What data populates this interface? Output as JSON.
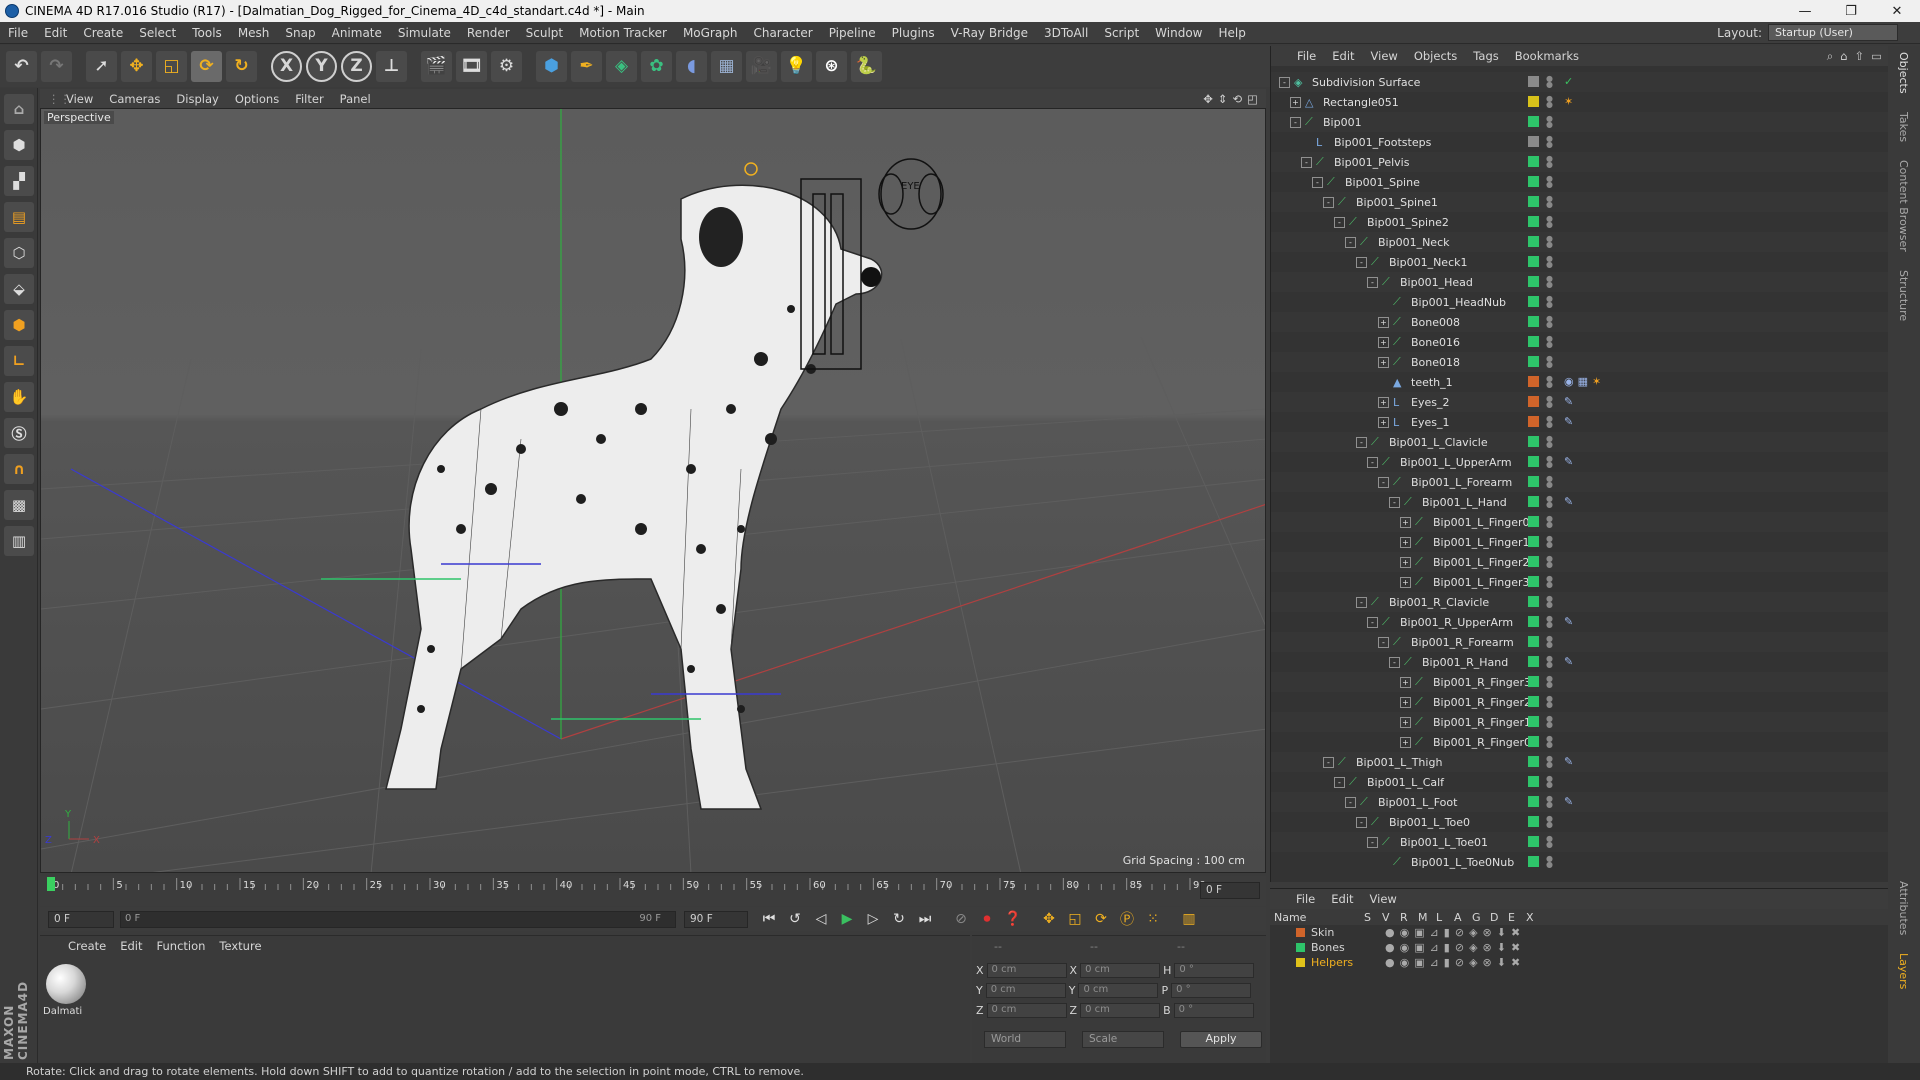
{
  "window": {
    "title": "CINEMA 4D R17.016 Studio (R17) - [Dalmatian_Dog_Rigged_for_Cinema_4D_c4d_standart.c4d *] - Main"
  },
  "menubar": {
    "items": [
      "File",
      "Edit",
      "Create",
      "Select",
      "Tools",
      "Mesh",
      "Snap",
      "Animate",
      "Simulate",
      "Render",
      "Sculpt",
      "Motion Tracker",
      "MoGraph",
      "Character",
      "Pipeline",
      "Plugins",
      "V-Ray Bridge",
      "3DToAll",
      "Script",
      "Window",
      "Help"
    ],
    "layout_label": "Layout:",
    "layout_value": "Startup (User)"
  },
  "toolbar": {
    "x_axis": "X",
    "y_axis": "Y",
    "z_axis": "Z"
  },
  "viewport": {
    "menu": [
      "View",
      "Cameras",
      "Display",
      "Options",
      "Filter",
      "Panel"
    ],
    "camera_label": "Perspective",
    "grid_spacing": "Grid Spacing : 100 cm",
    "sign_text": "EYE"
  },
  "timeline": {
    "ticks": [
      "0",
      "5",
      "10",
      "15",
      "20",
      "25",
      "30",
      "35",
      "40",
      "45",
      "50",
      "55",
      "60",
      "65",
      "70",
      "75",
      "80",
      "85",
      "90"
    ],
    "current_frame": "0 F",
    "start_field": "0 F",
    "range_start": "0 F",
    "range_end": "90 F",
    "end_field": "90 F"
  },
  "material_manager": {
    "menu": [
      "Create",
      "Edit",
      "Function",
      "Texture"
    ],
    "material_name": "Dalmati"
  },
  "coordinates": {
    "headers": [
      "--",
      "--",
      "--"
    ],
    "rows": [
      {
        "a": "X",
        "av": "0 cm",
        "b": "X",
        "bv": "0 cm",
        "c": "H",
        "cv": "0 °"
      },
      {
        "a": "Y",
        "av": "0 cm",
        "b": "Y",
        "bv": "0 cm",
        "c": "P",
        "cv": "0 °"
      },
      {
        "a": "Z",
        "av": "0 cm",
        "b": "Z",
        "bv": "0 cm",
        "c": "B",
        "cv": "0 °"
      }
    ],
    "mode": "World",
    "mode2": "Scale",
    "apply": "Apply"
  },
  "object_manager": {
    "menu": [
      "File",
      "Edit",
      "View",
      "Objects",
      "Tags",
      "Bookmarks"
    ],
    "objects": [
      {
        "name": "Subdivision Surface",
        "depth": 0,
        "exp": "-",
        "icon": "subdivision-icon",
        "color": "#8a8a8a",
        "tags": [
          "✓"
        ]
      },
      {
        "name": "Rectangle051",
        "depth": 1,
        "exp": "+",
        "icon": "spline-icon",
        "color": "#d8c21a",
        "tags": [
          "✶"
        ]
      },
      {
        "name": "Bip001",
        "depth": 1,
        "exp": "-",
        "icon": "bone-icon",
        "color": "#2ec46a",
        "tags": []
      },
      {
        "name": "Bip001_Footsteps",
        "depth": 2,
        "exp": "",
        "icon": "null-icon",
        "color": "#8a8a8a",
        "tags": []
      },
      {
        "name": "Bip001_Pelvis",
        "depth": 2,
        "exp": "-",
        "icon": "bone-icon",
        "color": "#2ec46a",
        "tags": []
      },
      {
        "name": "Bip001_Spine",
        "depth": 3,
        "exp": "-",
        "icon": "bone-icon",
        "color": "#2ec46a",
        "tags": []
      },
      {
        "name": "Bip001_Spine1",
        "depth": 4,
        "exp": "-",
        "icon": "bone-icon",
        "color": "#2ec46a",
        "tags": []
      },
      {
        "name": "Bip001_Spine2",
        "depth": 5,
        "exp": "-",
        "icon": "bone-icon",
        "color": "#2ec46a",
        "tags": []
      },
      {
        "name": "Bip001_Neck",
        "depth": 6,
        "exp": "-",
        "icon": "bone-icon",
        "color": "#2ec46a",
        "tags": []
      },
      {
        "name": "Bip001_Neck1",
        "depth": 7,
        "exp": "-",
        "icon": "bone-icon",
        "color": "#2ec46a",
        "tags": []
      },
      {
        "name": "Bip001_Head",
        "depth": 8,
        "exp": "-",
        "icon": "bone-icon",
        "color": "#2ec46a",
        "tags": []
      },
      {
        "name": "Bip001_HeadNub",
        "depth": 9,
        "exp": "",
        "icon": "bone-icon",
        "color": "#2ec46a",
        "tags": []
      },
      {
        "name": "Bone008",
        "depth": 9,
        "exp": "+",
        "icon": "bone-icon",
        "color": "#2ec46a",
        "tags": []
      },
      {
        "name": "Bone016",
        "depth": 9,
        "exp": "+",
        "icon": "bone-icon",
        "color": "#2ec46a",
        "tags": []
      },
      {
        "name": "Bone018",
        "depth": 9,
        "exp": "+",
        "icon": "bone-icon",
        "color": "#2ec46a",
        "tags": []
      },
      {
        "name": "teeth_1",
        "depth": 9,
        "exp": "",
        "icon": "mesh-icon",
        "color": "#d0642a",
        "tags": [
          "◉",
          "▦",
          "✶"
        ]
      },
      {
        "name": "Eyes_2",
        "depth": 9,
        "exp": "+",
        "icon": "null-icon",
        "color": "#d0642a",
        "tags": [
          "✎"
        ]
      },
      {
        "name": "Eyes_1",
        "depth": 9,
        "exp": "+",
        "icon": "null-icon",
        "color": "#d0642a",
        "tags": [
          "✎"
        ]
      },
      {
        "name": "Bip001_L_Clavicle",
        "depth": 7,
        "exp": "-",
        "icon": "bone-icon",
        "color": "#2ec46a",
        "tags": []
      },
      {
        "name": "Bip001_L_UpperArm",
        "depth": 8,
        "exp": "-",
        "icon": "bone-icon",
        "color": "#2ec46a",
        "tags": [
          "✎"
        ]
      },
      {
        "name": "Bip001_L_Forearm",
        "depth": 9,
        "exp": "-",
        "icon": "bone-icon",
        "color": "#2ec46a",
        "tags": []
      },
      {
        "name": "Bip001_L_Hand",
        "depth": 10,
        "exp": "-",
        "icon": "bone-icon",
        "color": "#2ec46a",
        "tags": [
          "✎"
        ]
      },
      {
        "name": "Bip001_L_Finger0",
        "depth": 11,
        "exp": "+",
        "icon": "bone-icon",
        "color": "#2ec46a",
        "tags": []
      },
      {
        "name": "Bip001_L_Finger1",
        "depth": 11,
        "exp": "+",
        "icon": "bone-icon",
        "color": "#2ec46a",
        "tags": []
      },
      {
        "name": "Bip001_L_Finger2",
        "depth": 11,
        "exp": "+",
        "icon": "bone-icon",
        "color": "#2ec46a",
        "tags": []
      },
      {
        "name": "Bip001_L_Finger3",
        "depth": 11,
        "exp": "+",
        "icon": "bone-icon",
        "color": "#2ec46a",
        "tags": []
      },
      {
        "name": "Bip001_R_Clavicle",
        "depth": 7,
        "exp": "-",
        "icon": "bone-icon",
        "color": "#2ec46a",
        "tags": []
      },
      {
        "name": "Bip001_R_UpperArm",
        "depth": 8,
        "exp": "-",
        "icon": "bone-icon",
        "color": "#2ec46a",
        "tags": [
          "✎"
        ]
      },
      {
        "name": "Bip001_R_Forearm",
        "depth": 9,
        "exp": "-",
        "icon": "bone-icon",
        "color": "#2ec46a",
        "tags": []
      },
      {
        "name": "Bip001_R_Hand",
        "depth": 10,
        "exp": "-",
        "icon": "bone-icon",
        "color": "#2ec46a",
        "tags": [
          "✎"
        ]
      },
      {
        "name": "Bip001_R_Finger3",
        "depth": 11,
        "exp": "+",
        "icon": "bone-icon",
        "color": "#2ec46a",
        "tags": []
      },
      {
        "name": "Bip001_R_Finger2",
        "depth": 11,
        "exp": "+",
        "icon": "bone-icon",
        "color": "#2ec46a",
        "tags": []
      },
      {
        "name": "Bip001_R_Finger1",
        "depth": 11,
        "exp": "+",
        "icon": "bone-icon",
        "color": "#2ec46a",
        "tags": []
      },
      {
        "name": "Bip001_R_Finger0",
        "depth": 11,
        "exp": "+",
        "icon": "bone-icon",
        "color": "#2ec46a",
        "tags": []
      },
      {
        "name": "Bip001_L_Thigh",
        "depth": 4,
        "exp": "-",
        "icon": "bone-icon",
        "color": "#2ec46a",
        "tags": [
          "✎"
        ]
      },
      {
        "name": "Bip001_L_Calf",
        "depth": 5,
        "exp": "-",
        "icon": "bone-icon",
        "color": "#2ec46a",
        "tags": []
      },
      {
        "name": "Bip001_L_Foot",
        "depth": 6,
        "exp": "-",
        "icon": "bone-icon",
        "color": "#2ec46a",
        "tags": [
          "✎"
        ]
      },
      {
        "name": "Bip001_L_Toe0",
        "depth": 7,
        "exp": "-",
        "icon": "bone-icon",
        "color": "#2ec46a",
        "tags": []
      },
      {
        "name": "Bip001_L_Toe01",
        "depth": 8,
        "exp": "-",
        "icon": "bone-icon",
        "color": "#2ec46a",
        "tags": []
      },
      {
        "name": "Bip001_L_Toe0Nub",
        "depth": 9,
        "exp": "",
        "icon": "bone-icon",
        "color": "#2ec46a",
        "tags": []
      }
    ]
  },
  "side_tabs": [
    "Objects",
    "Takes",
    "Content Browser",
    "Structure",
    "Attributes",
    "Layers"
  ],
  "layer_manager": {
    "menu": [
      "File",
      "Edit",
      "View"
    ],
    "columns": [
      "Name",
      "S",
      "V",
      "R",
      "M",
      "L",
      "A",
      "G",
      "D",
      "E",
      "X"
    ],
    "layers": [
      {
        "name": "Skin",
        "color": "#d0642a"
      },
      {
        "name": "Bones",
        "color": "#2ec46a"
      },
      {
        "name": "Helpers",
        "color": "#e0c21a"
      }
    ]
  },
  "status_bar": {
    "text": "Rotate: Click and drag to rotate elements. Hold down SHIFT to add to quantize rotation / add to the selection in point mode, CTRL to remove."
  }
}
